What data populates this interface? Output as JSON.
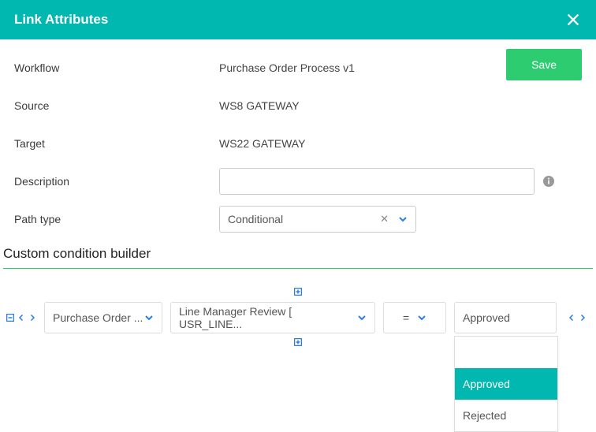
{
  "header": {
    "title": "Link Attributes"
  },
  "buttons": {
    "save": "Save"
  },
  "form": {
    "workflow_label": "Workflow",
    "workflow_value": "Purchase Order Process v1",
    "source_label": "Source",
    "source_value": "WS8 GATEWAY",
    "target_label": "Target",
    "target_value": "WS22 GATEWAY",
    "description_label": "Description",
    "description_value": "",
    "pathtype_label": "Path type",
    "pathtype_value": "Conditional"
  },
  "builder": {
    "section_title": "Custom condition builder",
    "field1": "Purchase Order ...",
    "field2": "Line Manager Review [ USR_LINE...",
    "operator": "=",
    "value": "Approved",
    "options": {
      "blank": "",
      "approved": "Approved",
      "rejected": "Rejected"
    }
  }
}
